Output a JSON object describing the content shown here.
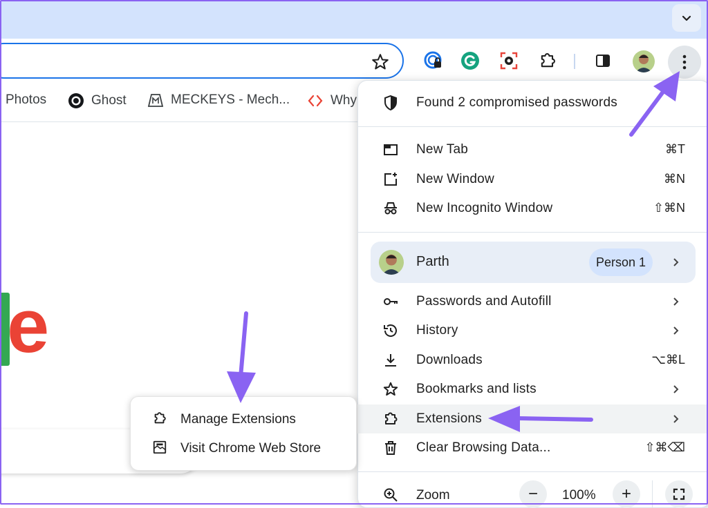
{
  "bookmarks": [
    {
      "label": "Photos",
      "icon": "photos-icon"
    },
    {
      "label": "Ghost",
      "icon": "ghost-icon"
    },
    {
      "label": "MECKEYS - Mech...",
      "icon": "meckeys-icon"
    },
    {
      "label": "Why",
      "icon": "code-icon"
    }
  ],
  "page": {
    "logo_letter": "e"
  },
  "menu": {
    "compromised": "Found 2 compromised passwords",
    "new_tab": {
      "label": "New Tab",
      "shortcut": "⌘T"
    },
    "new_window": {
      "label": "New Window",
      "shortcut": "⌘N"
    },
    "incognito": {
      "label": "New Incognito Window",
      "shortcut": "⇧⌘N"
    },
    "profile": {
      "name": "Parth",
      "badge": "Person 1"
    },
    "passwords": {
      "label": "Passwords and Autofill"
    },
    "history": {
      "label": "History"
    },
    "downloads": {
      "label": "Downloads",
      "shortcut": "⌥⌘L"
    },
    "bookmarks": {
      "label": "Bookmarks and lists"
    },
    "extensions": {
      "label": "Extensions"
    },
    "clear": {
      "label": "Clear Browsing Data...",
      "shortcut": "⇧⌘⌫"
    },
    "zoom": {
      "label": "Zoom",
      "minus": "−",
      "value": "100%",
      "plus": "+"
    }
  },
  "submenu": {
    "manage": "Manage Extensions",
    "store": "Visit Chrome Web Store"
  },
  "colors": {
    "accent": "#1a73e8",
    "annotation_arrow": "#8a63f2",
    "menu_highlight": "#f1f3f4"
  }
}
